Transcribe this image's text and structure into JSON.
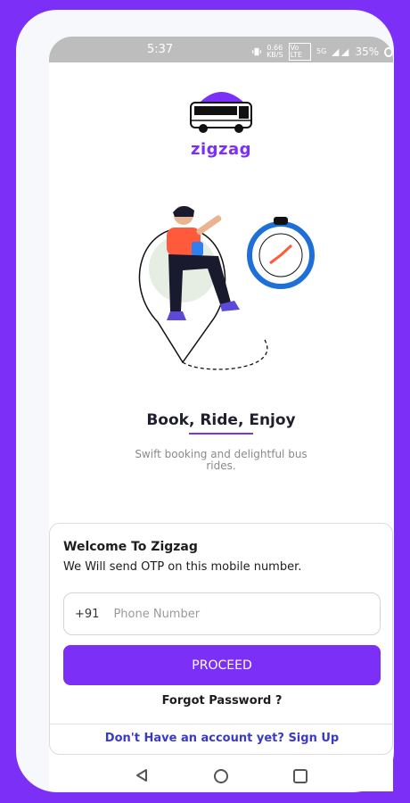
{
  "colors": {
    "accent": "#7b2ff7",
    "link": "#3a3ac8",
    "background": "#7b2ff7"
  },
  "status_bar": {
    "time": "5:37",
    "network_speed": "0.66",
    "network_unit": "KB/S",
    "volte": "Vo LTE",
    "signal_label": "5G",
    "battery": "35%"
  },
  "brand": {
    "name": "zigzag",
    "logo_icon": "bus-logo-icon"
  },
  "hero": {
    "illustration": "traveler-compass-illustration",
    "title": "Book, Ride, Enjoy",
    "subtitle": "Swift booking and delightful bus rides."
  },
  "login": {
    "title": "Welcome To Zigzag",
    "description": "We Will send OTP on this mobile number.",
    "country_code": "+91",
    "phone_placeholder": "Phone Number",
    "phone_value": "",
    "proceed_label": "PROCEED",
    "forgot_label": "Forgot Password ?",
    "signup_label": "Don't Have an account yet? Sign Up"
  },
  "nav": {
    "back": "back-icon",
    "home": "home-icon",
    "recents": "recents-icon"
  }
}
